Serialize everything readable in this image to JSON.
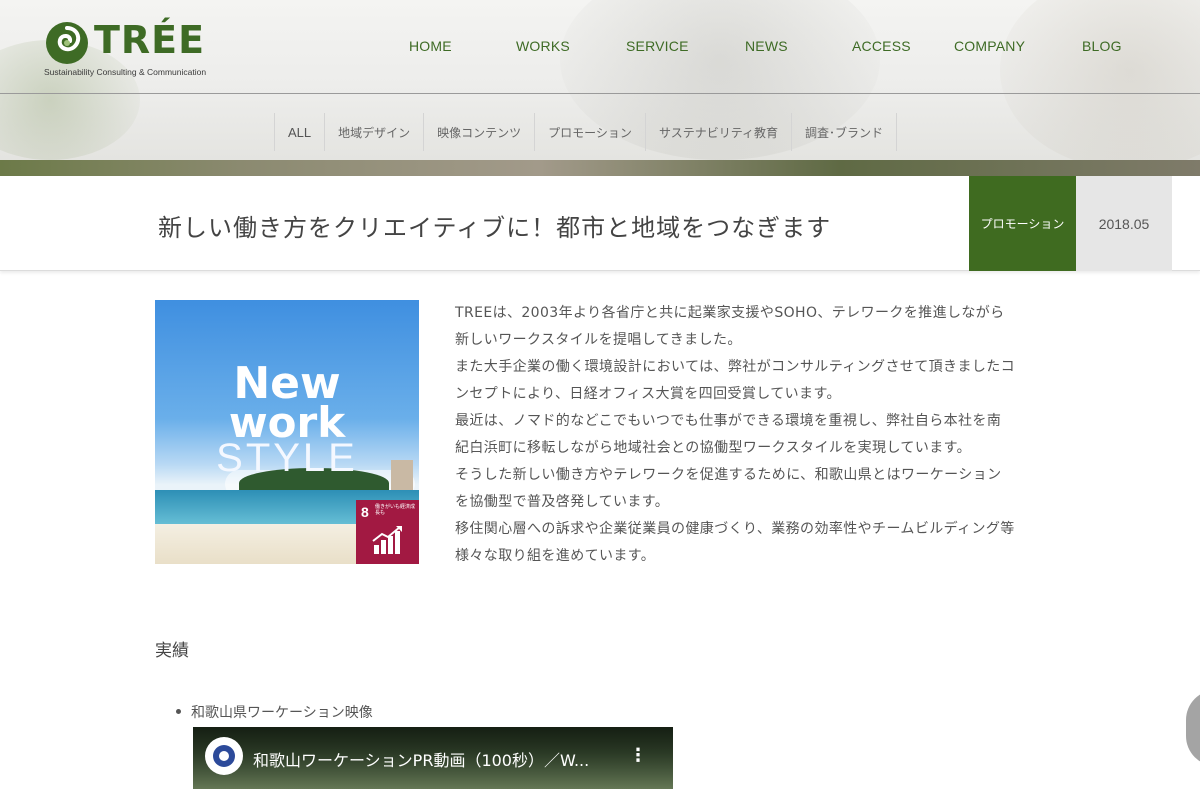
{
  "brand": {
    "name": "TRÉE",
    "tagline": "Sustainability Consulting & Communication",
    "color": "#3e6b25"
  },
  "nav": {
    "items": [
      "HOME",
      "WORKS",
      "SERVICE",
      "NEWS",
      "ACCESS",
      "COMPANY",
      "BLOG"
    ]
  },
  "categories": [
    "ALL",
    "地域デザイン",
    "映像コンテンツ",
    "プロモーション",
    "サステナビリティ教育",
    "調査･ブランド"
  ],
  "article": {
    "title": "新しい働き方をクリエイティブに！都市と地域をつなぎます",
    "category": "プロモーション",
    "date": "2018.05",
    "category_color": "#3f6b20"
  },
  "thumbnail": {
    "line1": "New",
    "line2": "work",
    "line3": "STYLE",
    "sdg_number": "8",
    "sdg_label": "働きがいも経済成長も",
    "sdg_color": "#a21942"
  },
  "body": [
    "TREEは、2003年より各省庁と共に起業家支援やSOHO、テレワークを推進しながら",
    "新しいワークスタイルを提唱してきました。",
    "また大手企業の働く環境設計においては、弊社がコンサルティングさせて頂きましたコ",
    "ンセプトにより、日経オフィス大賞を四回受賞しています。",
    "最近は、ノマド的などこでもいつでも仕事ができる環境を重視し、弊社自ら本社を南",
    "紀白浜町に移転しながら地域社会との協働型ワークスタイルを実現しています。",
    "そうした新しい働き方やテレワークを促進するために、和歌山県とはワーケーション",
    "を協働型で普及啓発しています。",
    "移住関心層への訴求や企業従業員の健康づくり、業務の効率性やチームビルディング等",
    "様々な取り組を進めています。"
  ],
  "achievements": {
    "heading": "実績",
    "items": [
      "和歌山県ワーケーション映像"
    ]
  },
  "video": {
    "title": "和歌山ワーケーションPR動画（100秒）／W...",
    "menu_glyph": "⋮"
  }
}
